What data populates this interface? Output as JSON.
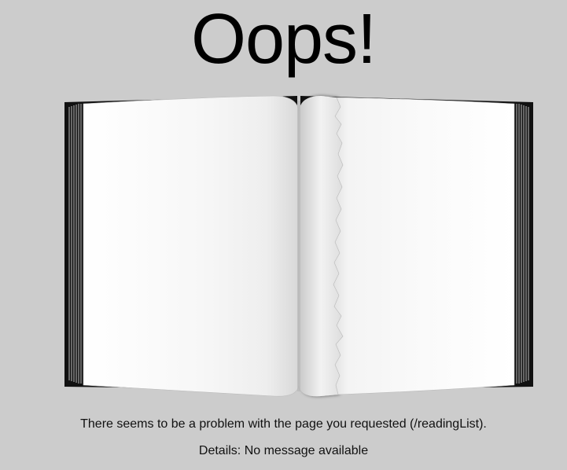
{
  "heading": "Oops!",
  "illustration": {
    "icon": "torn-book-icon",
    "colors": {
      "background": "#cccccc",
      "cover": "#111111",
      "page": "#fafafa"
    }
  },
  "error": {
    "message": "There seems to be a problem with the page you requested (/readingList).",
    "details": "Details: No message available"
  }
}
